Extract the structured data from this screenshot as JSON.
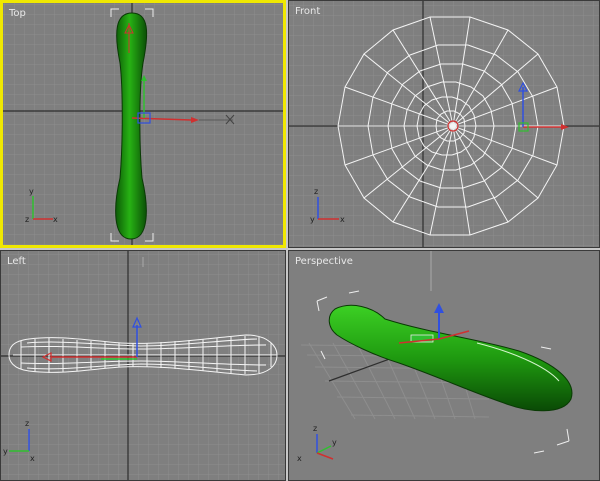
{
  "viewports": {
    "top": {
      "label": "Top",
      "active": true
    },
    "front": {
      "label": "Front",
      "active": false
    },
    "left": {
      "label": "Left",
      "active": false
    },
    "perspective": {
      "label": "Perspective",
      "active": false
    }
  },
  "axis_labels": {
    "x": "x",
    "y": "y",
    "z": "z"
  },
  "colors": {
    "viewport_bg": "#7f7f7f",
    "active_border": "#f0e800",
    "object_fill": "#1e9b10",
    "wireframe": "#f4f4f4",
    "gizmo_x": "#d03030",
    "gizmo_y": "#30c030",
    "gizmo_z": "#3050e0"
  },
  "icons": [
    "axis-tripod-icon",
    "transform-gizmo-icon",
    "bounding-bracket-icon"
  ]
}
